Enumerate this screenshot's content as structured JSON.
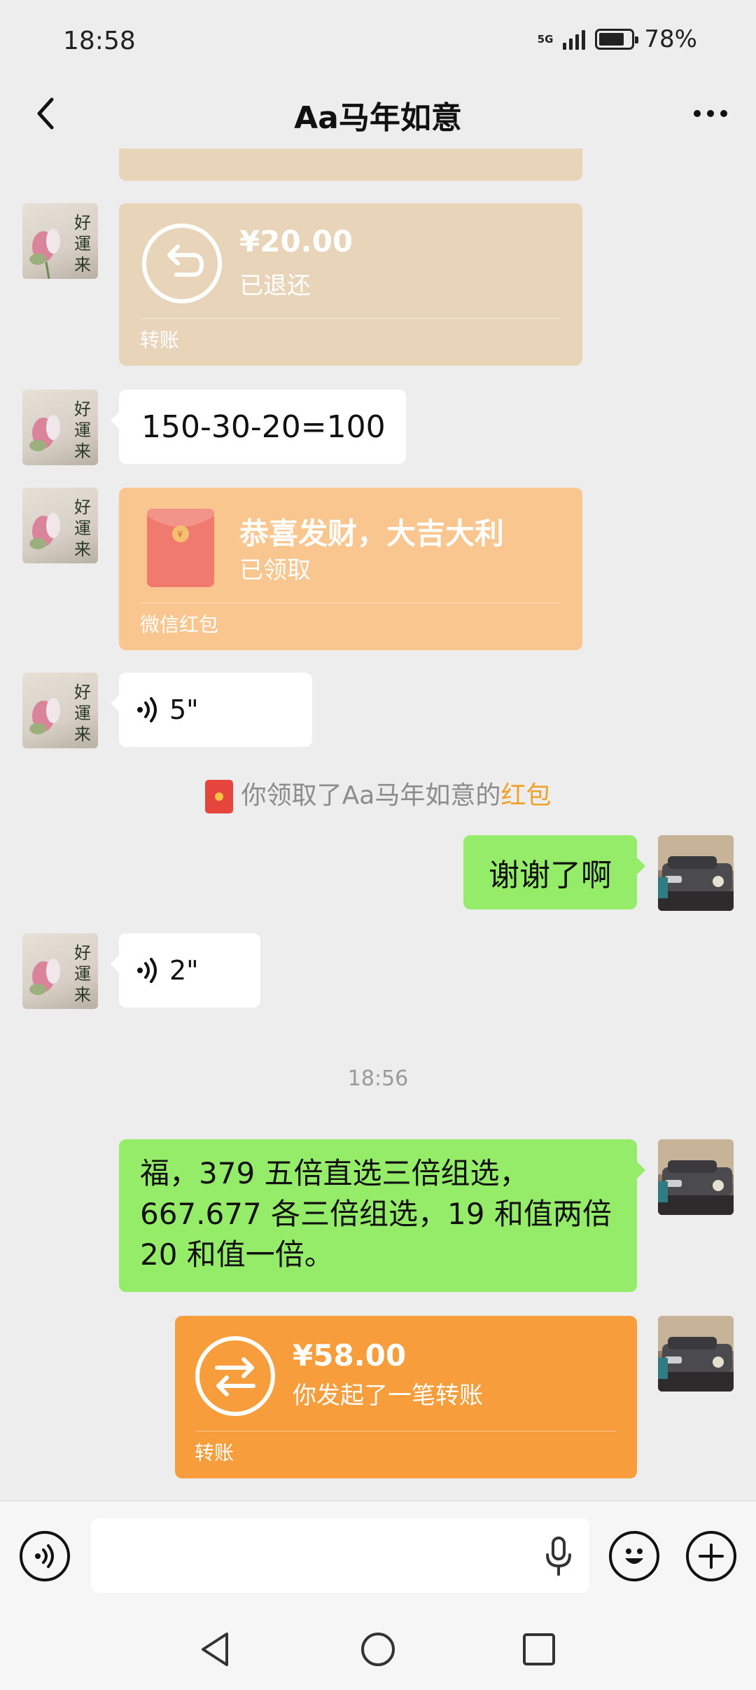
{
  "status_bar": {
    "time": "18:58",
    "network": "5G",
    "battery_percent": "78%",
    "battery_level": 0.78
  },
  "header": {
    "title": "Aa马年如意",
    "back_icon": "chevron-left-icon",
    "more_icon": "more-dots-icon"
  },
  "messages": {
    "transfer_returned": {
      "amount": "¥20.00",
      "status": "已退还",
      "footer": "转账"
    },
    "text_math": "150-30-20=100",
    "red_packet": {
      "title": "恭喜发财，大吉大利",
      "status": "已领取",
      "footer": "微信红包"
    },
    "voice_1": "5\"",
    "system_note": {
      "prefix": "你领取了Aa马年如意的",
      "highlight": "红包"
    },
    "my_thanks": "谢谢了啊",
    "voice_2": "2\"",
    "timestamp": "18:56",
    "my_long_text": "福，379 五倍直选三倍组选，667.677 各三倍组选，19 和值两倍20 和值一倍。",
    "transfer_sent": {
      "amount": "¥58.00",
      "status": "你发起了一笔转账",
      "footer": "转账"
    }
  },
  "input_bar": {
    "voice_toggle_icon": "voice-icon",
    "mic_icon": "microphone-icon",
    "emoji_icon": "emoji-icon",
    "plus_icon": "plus-icon"
  },
  "nav_bar": {
    "back_icon": "triangle-back-icon",
    "home_icon": "circle-home-icon",
    "recents_icon": "square-recents-icon"
  },
  "colors": {
    "chat_bg": "#ededed",
    "my_bubble": "#95ec69",
    "transfer_returned": "#e8d4b8",
    "red_packet_received": "#f9c68f",
    "transfer_sent": "#f89d3c",
    "highlight_text": "#f0a12a"
  }
}
